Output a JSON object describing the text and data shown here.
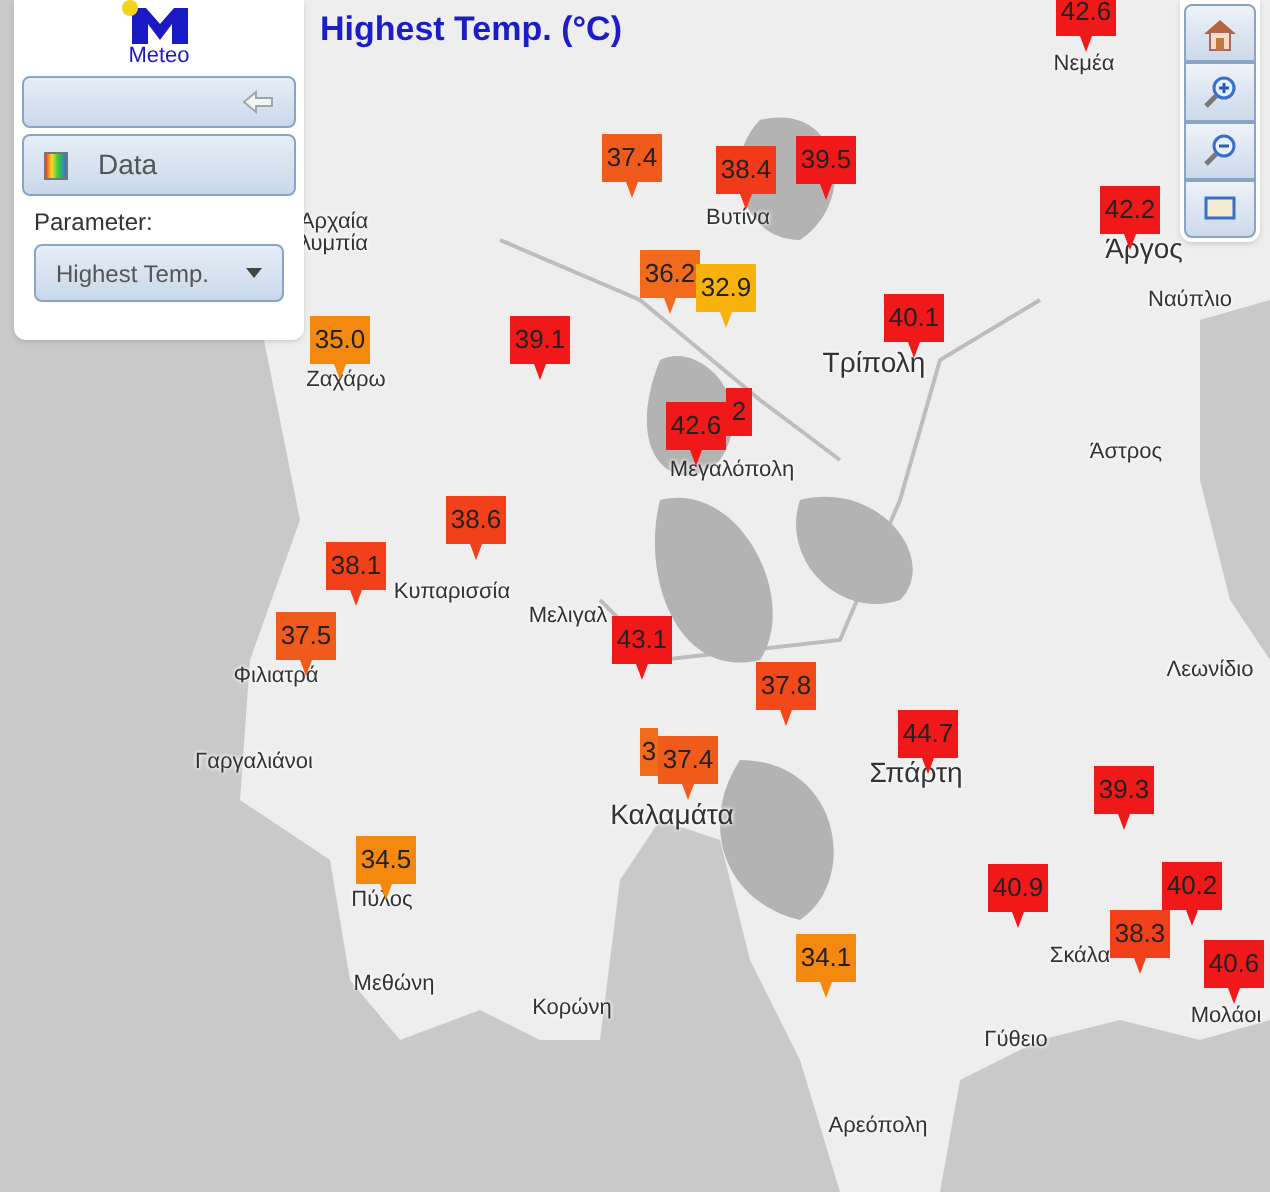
{
  "panel": {
    "logo_text": "Meteo",
    "data_button": "Data",
    "parameter_label": "Parameter:",
    "parameter_select": "Highest Temp."
  },
  "map_title": "Highest Temp. (°C)",
  "markers": [
    {
      "value": "42.6",
      "color": "#f01818"
    },
    {
      "value": "37.4",
      "color": "#f05a1a"
    },
    {
      "value": "38.4",
      "color": "#f03a1a"
    },
    {
      "value": "39.5",
      "color": "#f01818"
    },
    {
      "value": "42.2",
      "color": "#f01818"
    },
    {
      "value": "36.2",
      "color": "#f26a1c"
    },
    {
      "value": "32.9",
      "color": "#f7b20c"
    },
    {
      "value": "40.1",
      "color": "#f01818"
    },
    {
      "value": "35.0",
      "color": "#f5880e"
    },
    {
      "value": "39.1",
      "color": "#f01818"
    },
    {
      "value": "2",
      "color": "#f01818"
    },
    {
      "value": "42.6",
      "color": "#f01818"
    },
    {
      "value": "38.6",
      "color": "#f2401a"
    },
    {
      "value": "38.1",
      "color": "#f2401a"
    },
    {
      "value": "37.5",
      "color": "#f05a1a"
    },
    {
      "value": "43.1",
      "color": "#f01818"
    },
    {
      "value": "37.8",
      "color": "#f2481a"
    },
    {
      "value": "44.7",
      "color": "#f01818"
    },
    {
      "value": "3",
      "color": "#f26a1c"
    },
    {
      "value": "37.4",
      "color": "#f05a1a"
    },
    {
      "value": "39.3",
      "color": "#f01818"
    },
    {
      "value": "34.5",
      "color": "#f5880e"
    },
    {
      "value": "40.9",
      "color": "#f01818"
    },
    {
      "value": "40.2",
      "color": "#f01818"
    },
    {
      "value": "38.3",
      "color": "#f2401a"
    },
    {
      "value": "40.6",
      "color": "#f01818"
    },
    {
      "value": "34.1",
      "color": "#f5880e"
    }
  ],
  "towns": [
    "Νεμέα",
    "Αρχαία",
    "λυμπία",
    "Βυτίνα",
    "Άργος",
    "Ναύπλιο",
    "Τρίπολη",
    "Ζαχάρω",
    "Μεγαλόπολη",
    "Άστρος",
    "Κυπαρισσία",
    "Μελιγαλ",
    "Λεωνίδιο",
    "Φιλιατρά",
    "Σπάρτη",
    "Γαργαλιάνοι",
    "Καλαμάτα",
    "Πύλος",
    "Μεθώνη",
    "Κορώνη",
    "Σκάλα",
    "Μολάοι",
    "Γύθειο",
    "Αρεόπολη"
  ]
}
